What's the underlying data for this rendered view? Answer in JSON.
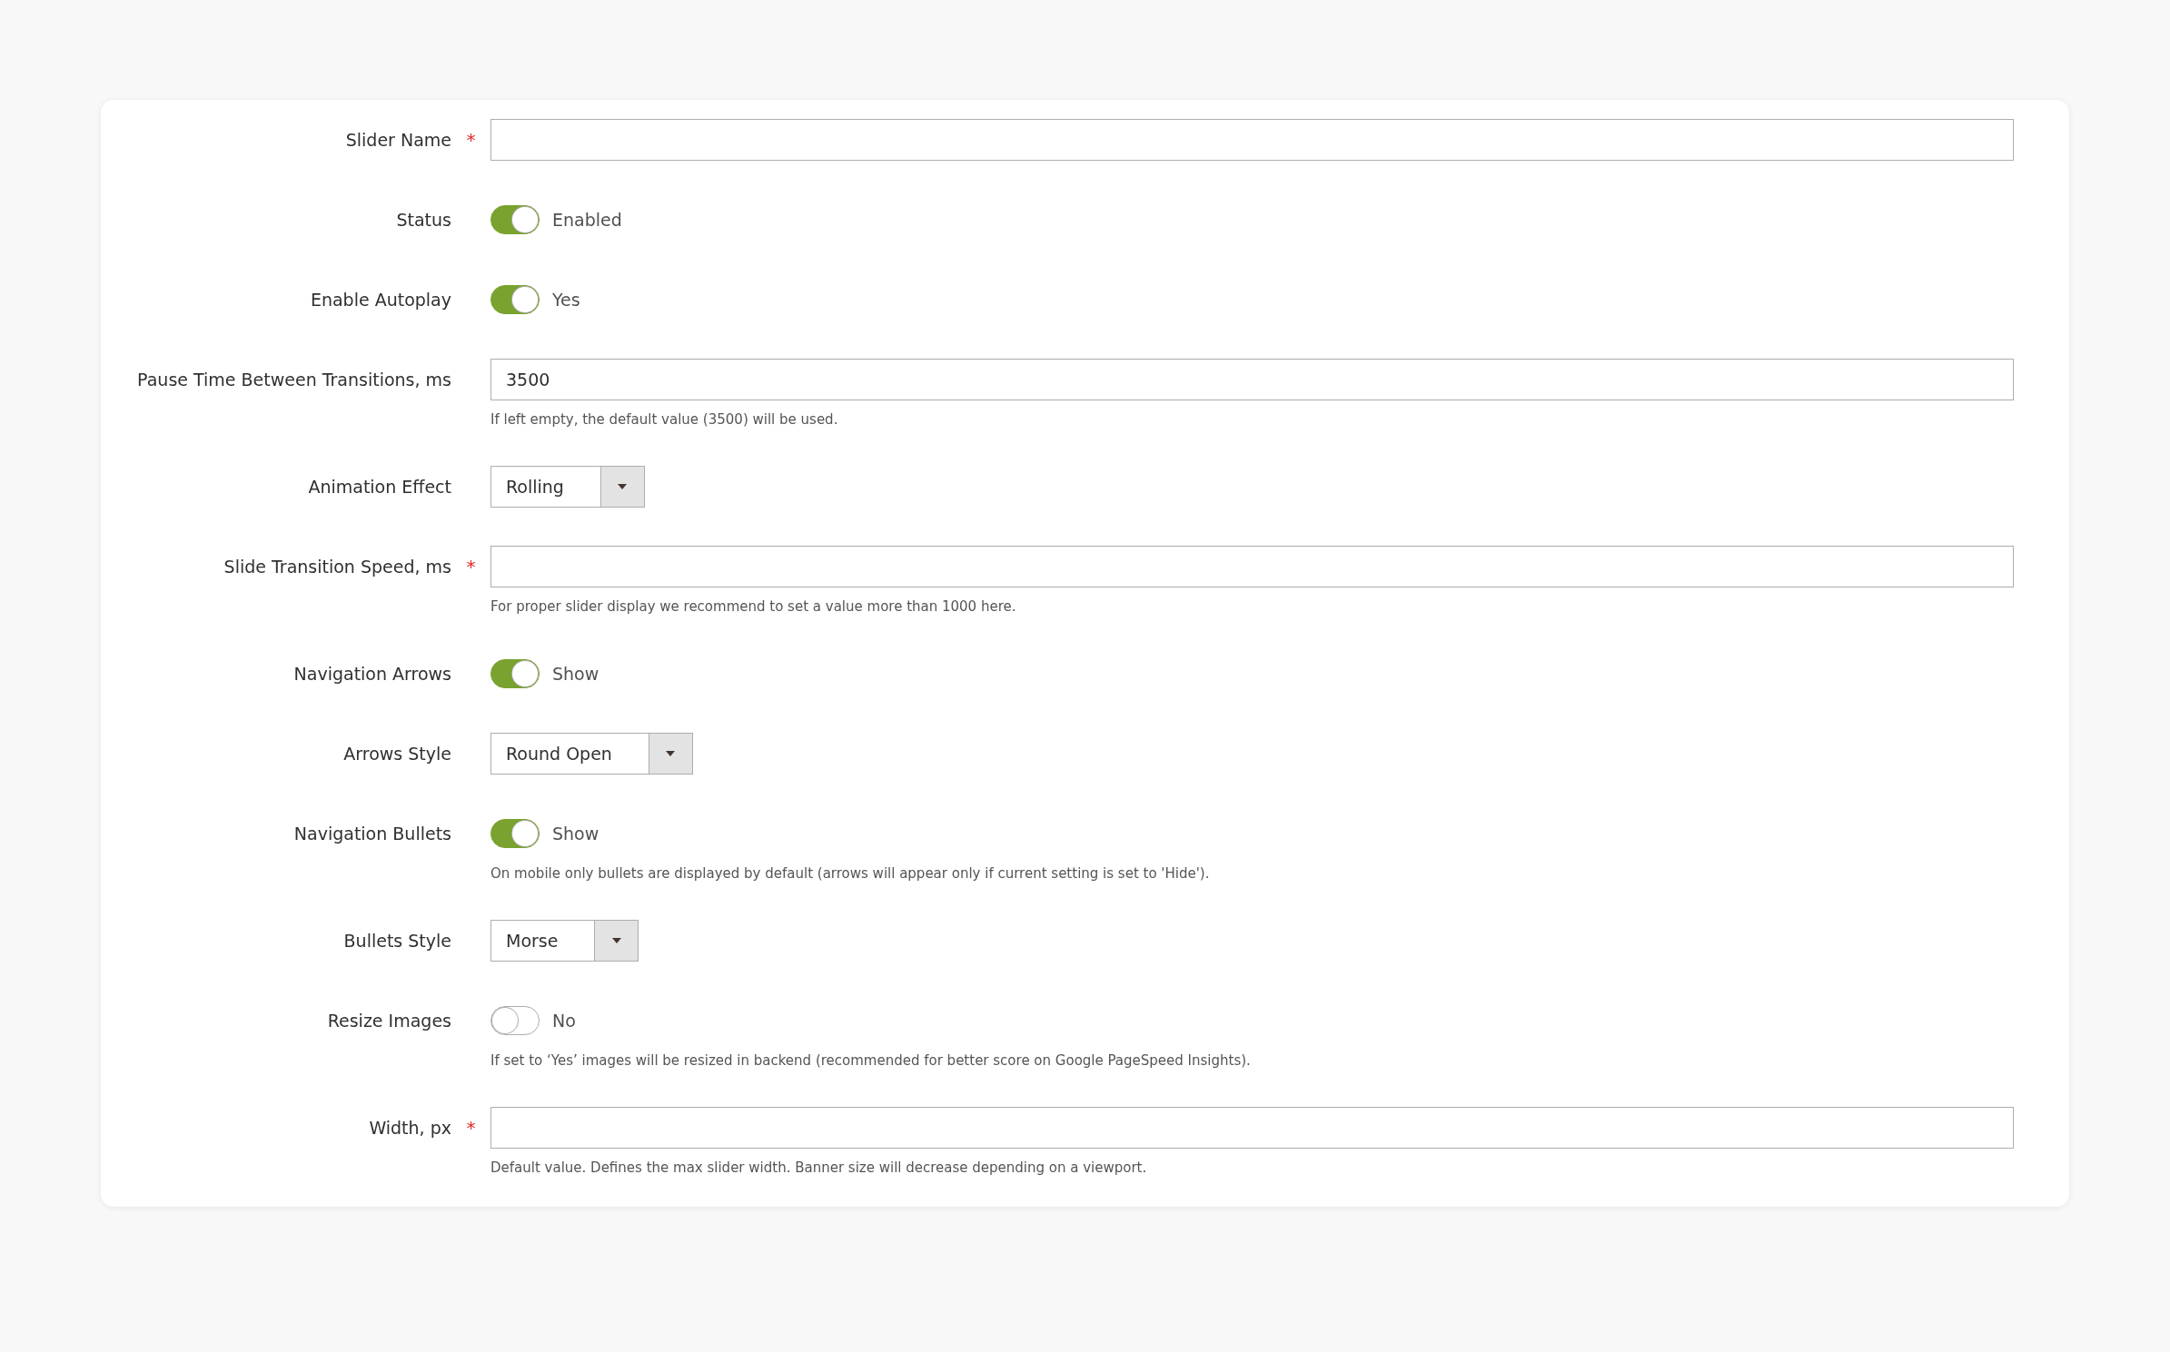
{
  "form": {
    "fields": [
      {
        "kind": "text",
        "label": "Slider Name",
        "required_mark": "*"
      },
      {
        "kind": "toggle",
        "label": "Status",
        "on": true,
        "state_label": "Enabled"
      },
      {
        "kind": "toggle",
        "label": "Enable Autoplay",
        "on": true,
        "state_label": "Yes"
      },
      {
        "kind": "text",
        "label": "Pause Time Between Transitions, ms",
        "value": "3500",
        "note": "If left empty, the default value (3500) will be used."
      },
      {
        "kind": "select",
        "label": "Animation Effect",
        "value": "Rolling"
      },
      {
        "kind": "text",
        "label": "Slide Transition Speed, ms",
        "required_mark": "*",
        "note": "For proper slider display we recommend to set a value more than 1000 here."
      },
      {
        "kind": "toggle",
        "label": "Navigation Arrows",
        "on": true,
        "state_label": "Show"
      },
      {
        "kind": "select",
        "label": "Arrows Style",
        "value": "Round Open"
      },
      {
        "kind": "toggle",
        "label": "Navigation Bullets",
        "on": true,
        "state_label": "Show",
        "note": "On mobile only bullets are displayed by default (arrows will appear only if current setting is set to 'Hide')."
      },
      {
        "kind": "select",
        "label": "Bullets Style",
        "value": "Morse"
      },
      {
        "kind": "toggle",
        "label": "Resize Images",
        "on": false,
        "state_label": "No",
        "note": "If set to ‘Yes’ images will be resized in backend (recommended for better score on Google PageSpeed Insights)."
      },
      {
        "kind": "text",
        "label": "Width, px",
        "required_mark": "*",
        "note": "Default value. Defines the max slider width. Banner size will decrease depending on a viewport."
      }
    ]
  }
}
